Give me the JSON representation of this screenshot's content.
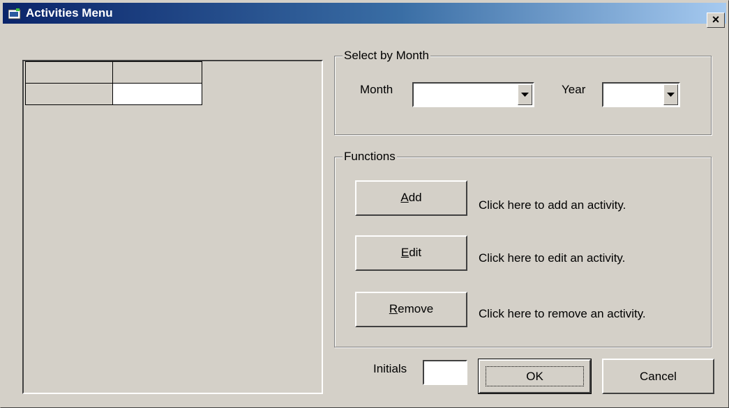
{
  "window": {
    "title": "Activities Menu",
    "close_label": "×"
  },
  "grid": {
    "rows": [
      [
        "",
        ""
      ],
      [
        "",
        ""
      ]
    ]
  },
  "select_by_month": {
    "legend": "Select by Month",
    "month_label": "Month",
    "month_value": "",
    "year_label": "Year",
    "year_value": ""
  },
  "functions": {
    "legend": "Functions",
    "add": {
      "mnemonic": "A",
      "rest": "dd",
      "description": "Click here to add an activity."
    },
    "edit": {
      "mnemonic": "E",
      "rest": "dit",
      "description": "Click here to edit an activity."
    },
    "remove": {
      "mnemonic": "R",
      "rest": "emove",
      "description": "Click here to remove an activity."
    }
  },
  "footer": {
    "initials_label": "Initials",
    "initials_value": "",
    "ok_label": "OK",
    "cancel_label": "Cancel"
  },
  "colors": {
    "face": "#d4d0c8",
    "title_start": "#0a246a",
    "title_end": "#a6caf0"
  }
}
